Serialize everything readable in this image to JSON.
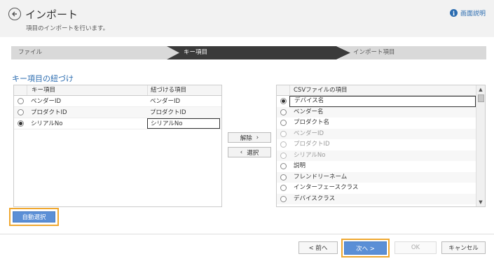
{
  "header": {
    "title": "インポート",
    "subtitle": "項目のインポートを行います。",
    "help_label": "画面説明",
    "help_icon": "info-icon"
  },
  "steps": [
    {
      "label": "ファイル",
      "state": "done"
    },
    {
      "label": "キー項目",
      "state": "current"
    },
    {
      "label": "インポート項目",
      "state": "pending"
    }
  ],
  "section_title": "キー項目の紐づけ",
  "key_table": {
    "columns": [
      "キー項目",
      "紐づける項目"
    ],
    "rows": [
      {
        "key": "ベンダーID",
        "mapped": "ベンダーID",
        "selected": false
      },
      {
        "key": "プロダクトID",
        "mapped": "プロダクトID",
        "selected": false
      },
      {
        "key": "シリアルNo",
        "mapped": "シリアルNo",
        "selected": true
      }
    ]
  },
  "middle": {
    "release_label": "解除",
    "select_label": "選択",
    "release_arrow": "›",
    "select_arrow": "‹"
  },
  "csv_table": {
    "column": "CSVファイルの項目",
    "rows": [
      {
        "name": "デバイス名",
        "selected": true,
        "disabled": false
      },
      {
        "name": "ベンダー名",
        "selected": false,
        "disabled": false
      },
      {
        "name": "プロダクト名",
        "selected": false,
        "disabled": false
      },
      {
        "name": "ベンダーID",
        "selected": false,
        "disabled": true
      },
      {
        "name": "プロダクトID",
        "selected": false,
        "disabled": true
      },
      {
        "name": "シリアルNo",
        "selected": false,
        "disabled": true
      },
      {
        "name": "説明",
        "selected": false,
        "disabled": false
      },
      {
        "name": "フレンドリーネーム",
        "selected": false,
        "disabled": false
      },
      {
        "name": "インターフェースクラス",
        "selected": false,
        "disabled": false
      },
      {
        "name": "デバイスクラス",
        "selected": false,
        "disabled": false
      }
    ]
  },
  "auto_select_label": "自動選択",
  "footer": {
    "prev_label": "< 前へ",
    "next_label": "次へ >",
    "ok_label": "OK",
    "cancel_label": "キャンセル"
  },
  "colors": {
    "accent": "#2b6cb0",
    "primary_button": "#5b8fd6",
    "highlight": "#f0a830",
    "current_step": "#3a3a3a"
  }
}
